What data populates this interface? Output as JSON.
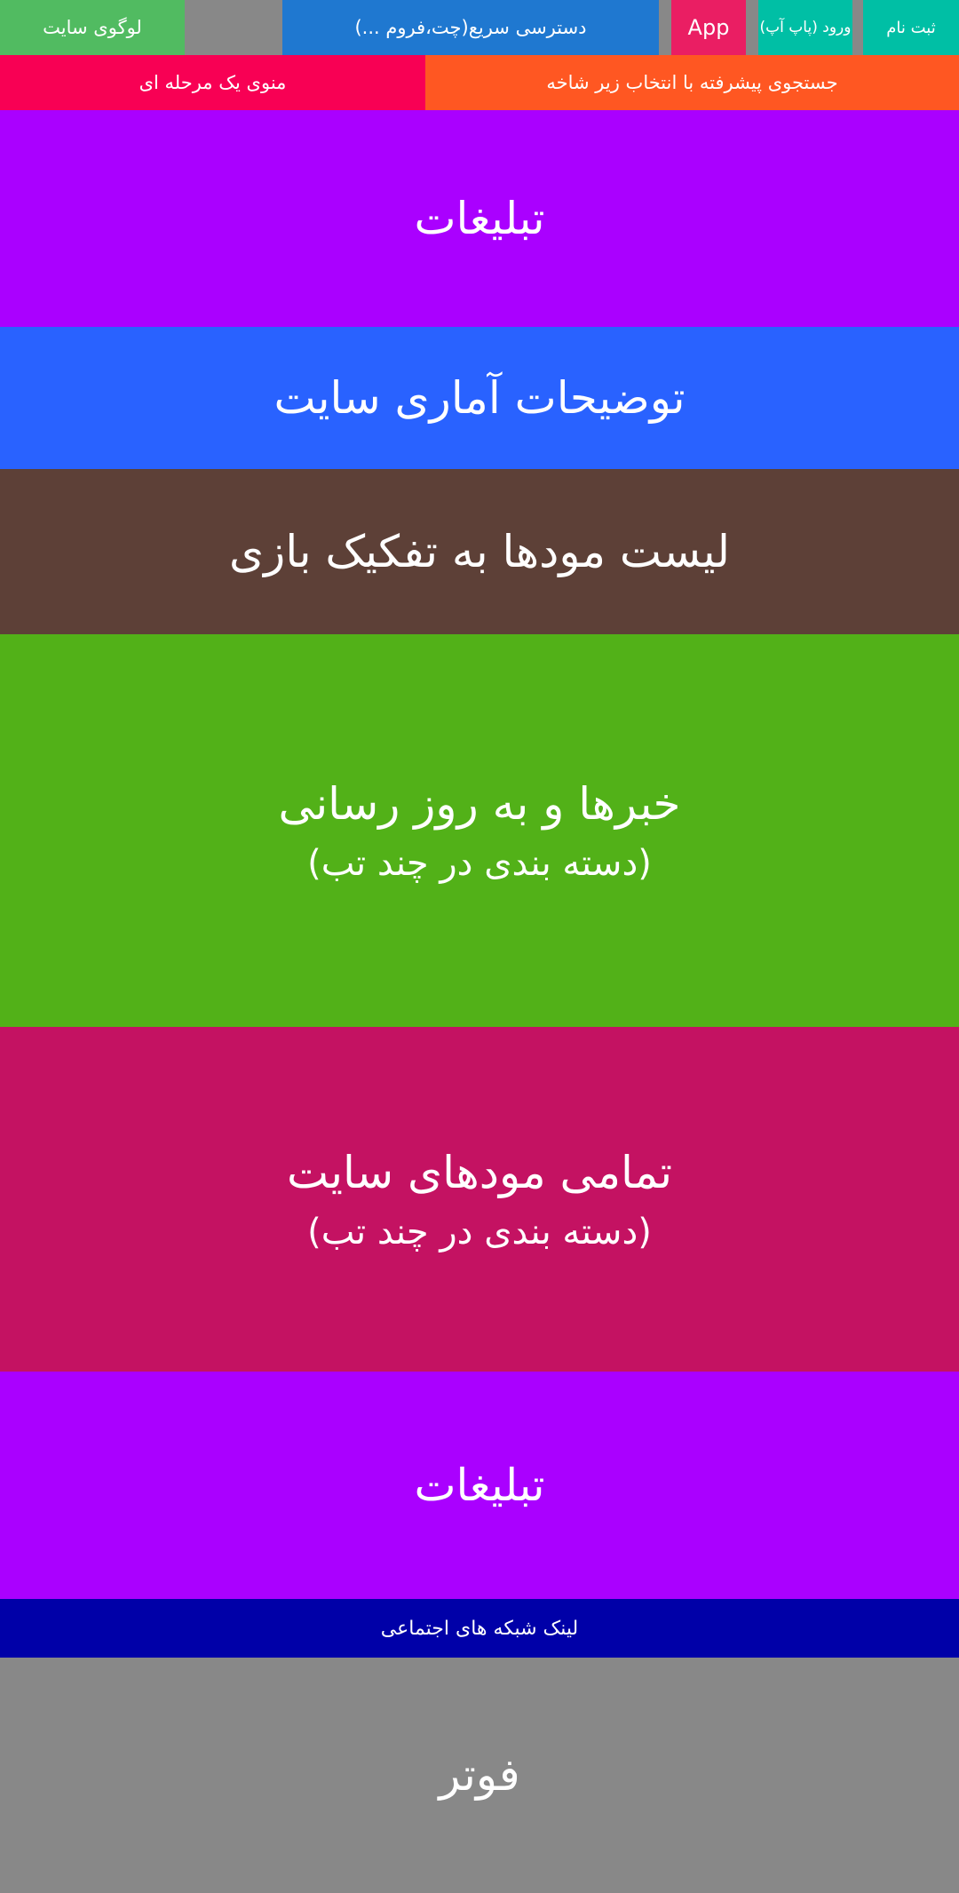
{
  "header": {
    "logo": "لوگوی سایت",
    "quick_access": "دسترسی سریع(چت،فروم ...)",
    "app": "App",
    "login": "ورود (پاپ آپ)",
    "register": "ثبت نام"
  },
  "nav": {
    "menu": "منوی یک مرحله ای",
    "search": "جستجوی پیشرفته با انتخاب زیر شاخه"
  },
  "sections": {
    "ads_top": "تبلیغات",
    "stats": "توضیحات آماری سایت",
    "mods_by_game": "لیست مودها به تفکیک بازی",
    "news_title": "خبرها و به روز رسانی",
    "news_sub": "(دسته بندی در چند تب)",
    "all_mods_title": "تمامی مودهای سایت",
    "all_mods_sub": "(دسته بندی در چند تب)",
    "ads_bottom": "تبلیغات",
    "social": "لینک شبکه های اجتماعی",
    "footer": "فوتر"
  },
  "colors": {
    "logo": "#51BB61",
    "gray": "#888888",
    "quick_access": "#1F78D0",
    "app": "#EA1E63",
    "teal": "#00BFA5",
    "menu": "#F80054",
    "search": "#FF5722",
    "ads": "#AA00FF",
    "stats": "#2962FF",
    "mods_by_game": "#5D4037",
    "news": "#52B118",
    "all_mods": "#C41262",
    "social": "#0000A8",
    "footer": "#888888"
  }
}
